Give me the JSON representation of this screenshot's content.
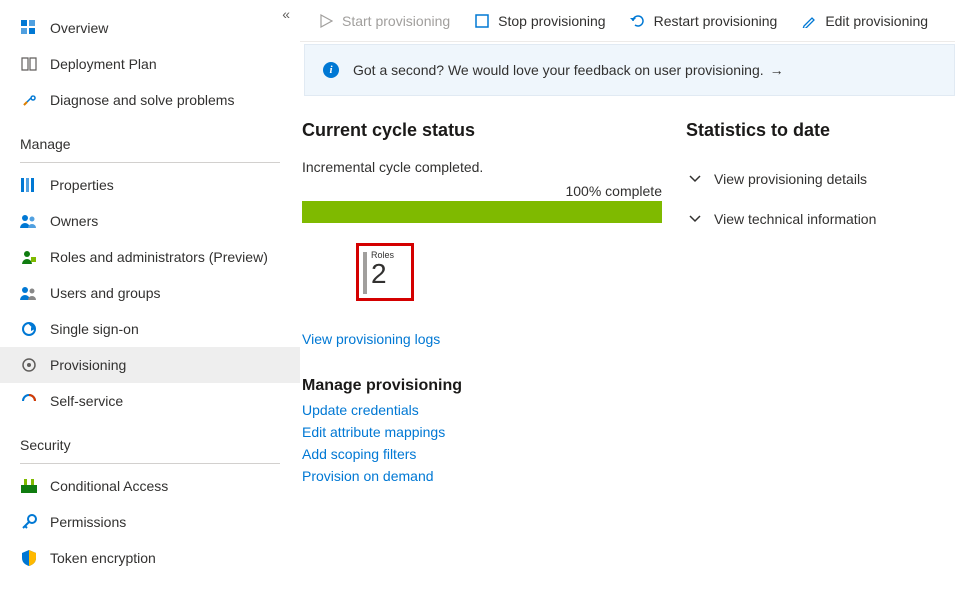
{
  "sidebar": {
    "top": [
      {
        "label": "Overview"
      },
      {
        "label": "Deployment Plan"
      },
      {
        "label": "Diagnose and solve problems"
      }
    ],
    "sections": [
      {
        "title": "Manage",
        "items": [
          {
            "label": "Properties"
          },
          {
            "label": "Owners"
          },
          {
            "label": "Roles and administrators (Preview)"
          },
          {
            "label": "Users and groups"
          },
          {
            "label": "Single sign-on"
          },
          {
            "label": "Provisioning",
            "selected": true
          },
          {
            "label": "Self-service"
          }
        ]
      },
      {
        "title": "Security",
        "items": [
          {
            "label": "Conditional Access"
          },
          {
            "label": "Permissions"
          },
          {
            "label": "Token encryption"
          }
        ]
      }
    ]
  },
  "commands": {
    "start": "Start provisioning",
    "stop": "Stop provisioning",
    "restart": "Restart provisioning",
    "edit": "Edit provisioning"
  },
  "feedback": {
    "text": "Got a second? We would love your feedback on user provisioning."
  },
  "cycle": {
    "heading": "Current cycle status",
    "status_text": "Incremental cycle completed.",
    "percent_label": "100% complete",
    "roles_label": "Roles",
    "roles_count": "2",
    "logs_link": "View provisioning logs"
  },
  "manage": {
    "heading": "Manage provisioning",
    "links": {
      "update": "Update credentials",
      "edit_mappings": "Edit attribute mappings",
      "scoping": "Add scoping filters",
      "on_demand": "Provision on demand"
    }
  },
  "stats": {
    "heading": "Statistics to date",
    "details": "View provisioning details",
    "technical": "View technical information"
  }
}
